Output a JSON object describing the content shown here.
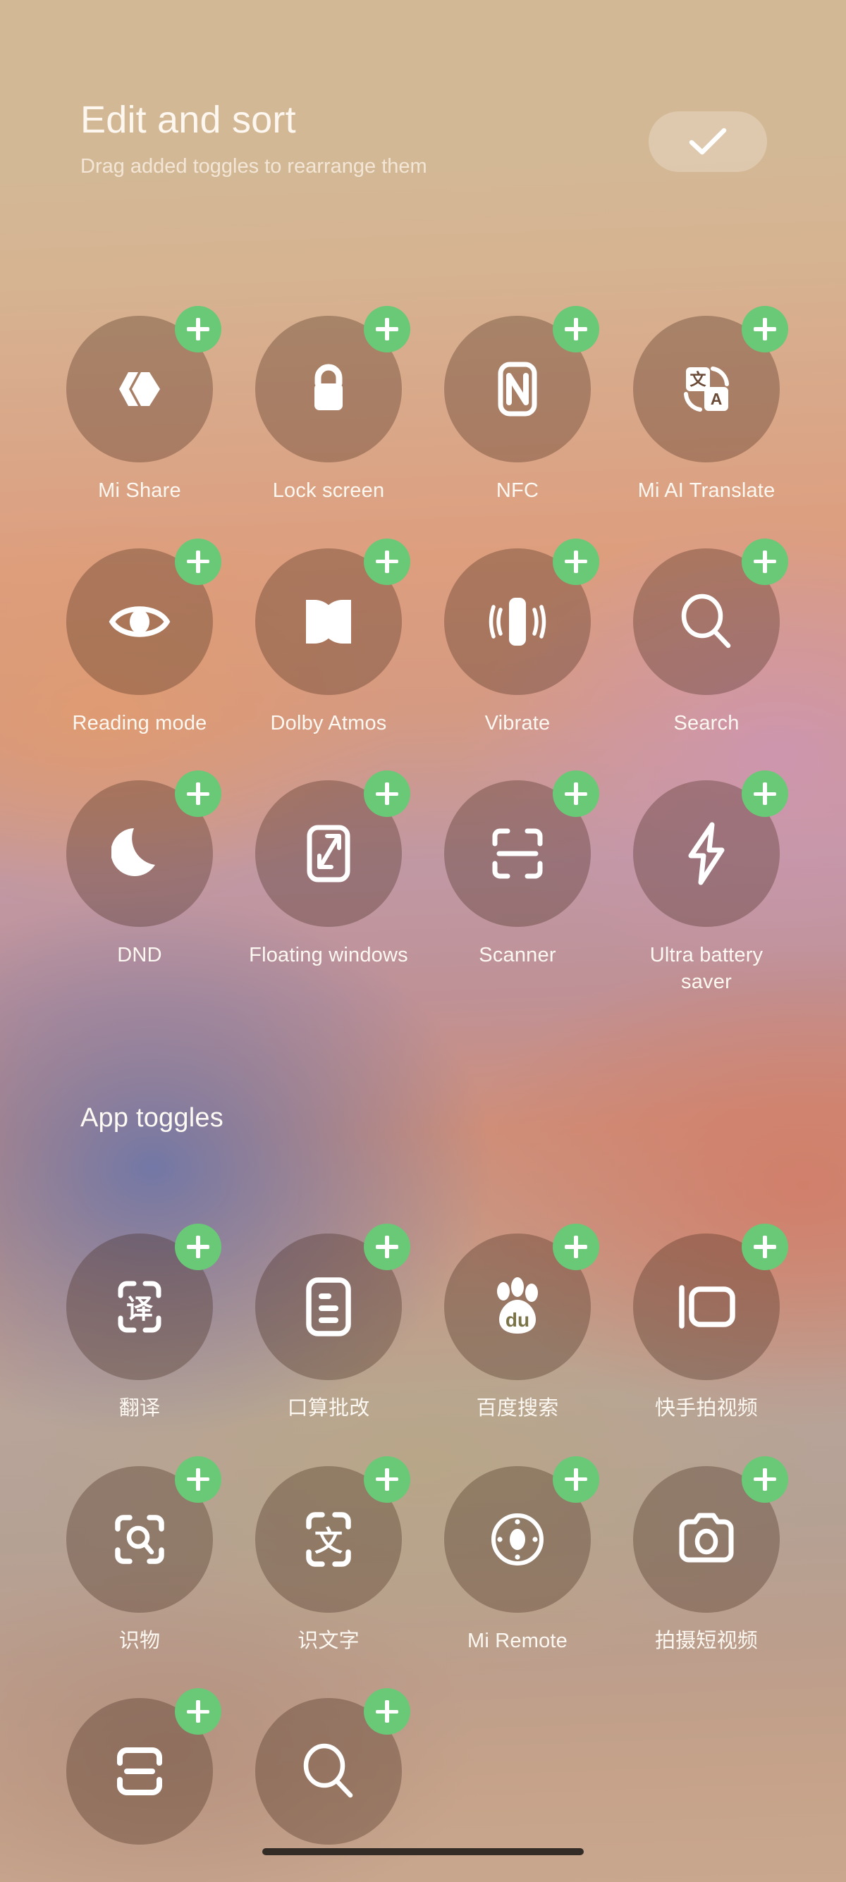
{
  "header": {
    "title": "Edit and sort",
    "subtitle": "Drag added toggles to rearrange them",
    "done_icon": "check-icon"
  },
  "theme": {
    "badge_green": "#69c977",
    "tile_fill": "rgba(56,30,16,0.30)",
    "text_primary": "#fdf8f1",
    "text_secondary": "rgba(255,248,238,0.72)",
    "home_indicator": "#332b26"
  },
  "system_toggles": {
    "items": [
      {
        "label": "Mi Share",
        "icon": "mi-share-icon",
        "badge": "add-badge"
      },
      {
        "label": "Lock screen",
        "icon": "lock-icon",
        "badge": "add-badge"
      },
      {
        "label": "NFC",
        "icon": "nfc-icon",
        "badge": "add-badge"
      },
      {
        "label": "Mi AI Translate",
        "icon": "mi-ai-translate-icon",
        "badge": "add-badge"
      },
      {
        "label": "Reading mode",
        "icon": "eye-icon",
        "badge": "add-badge"
      },
      {
        "label": "Dolby Atmos",
        "icon": "dolby-atmos-icon",
        "badge": "add-badge"
      },
      {
        "label": "Vibrate",
        "icon": "vibrate-icon",
        "badge": "add-badge"
      },
      {
        "label": "Search",
        "icon": "search-icon",
        "badge": "add-badge"
      },
      {
        "label": "DND",
        "icon": "moon-icon",
        "badge": "add-badge"
      },
      {
        "label": "Floating windows",
        "icon": "floating-windows-icon",
        "badge": "add-badge"
      },
      {
        "label": "Scanner",
        "icon": "scanner-icon",
        "badge": "add-badge"
      },
      {
        "label": "Ultra battery saver",
        "icon": "lightning-bolt-icon",
        "badge": "add-badge"
      }
    ]
  },
  "app_toggles": {
    "heading": "App toggles",
    "items": [
      {
        "label": "翻译",
        "icon": "translate-cn-icon",
        "badge": "add-badge"
      },
      {
        "label": "口算批改",
        "icon": "document-lines-icon",
        "badge": "add-badge"
      },
      {
        "label": "百度搜索",
        "icon": "baidu-paw-icon",
        "badge": "add-badge"
      },
      {
        "label": "快手拍视频",
        "icon": "video-camera-icon",
        "badge": "add-badge"
      },
      {
        "label": "识物",
        "icon": "object-scan-icon",
        "badge": "add-badge"
      },
      {
        "label": "识文字",
        "icon": "text-scan-icon",
        "badge": "add-badge"
      },
      {
        "label": "Mi Remote",
        "icon": "remote-control-icon",
        "badge": "add-badge"
      },
      {
        "label": "拍摄短视频",
        "icon": "camera-icon",
        "badge": "add-badge"
      },
      {
        "label": "",
        "icon": "barcode-scan-icon",
        "badge": "add-badge"
      },
      {
        "label": "",
        "icon": "magnifier-icon",
        "badge": "add-badge"
      }
    ]
  }
}
